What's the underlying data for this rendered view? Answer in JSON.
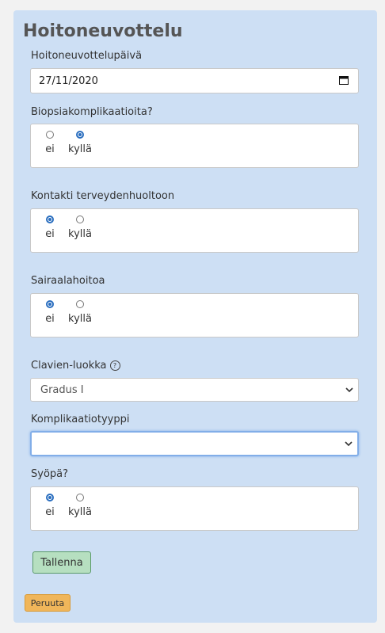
{
  "title": "Hoitoneuvottelu",
  "date": {
    "label": "Hoitoneuvottelupäivä",
    "value": "27/11/2020"
  },
  "biopsy": {
    "label": "Biopsiakomplikaatioita?",
    "opt_no": "ei",
    "opt_yes": "kyllä",
    "selected": "kyllä"
  },
  "contact": {
    "label": "Kontakti terveydenhuoltoon",
    "opt_no": "ei",
    "opt_yes": "kyllä",
    "selected": "ei"
  },
  "hospital": {
    "label": "Sairaalahoitoa",
    "opt_no": "ei",
    "opt_yes": "kyllä",
    "selected": "ei"
  },
  "clavien": {
    "label": "Clavien-luokka",
    "help": "?",
    "value": "Gradus I"
  },
  "complication_type": {
    "label": "Komplikaatiotyyppi",
    "value": ""
  },
  "cancer": {
    "label": "Syöpä?",
    "opt_no": "ei",
    "opt_yes": "kyllä",
    "selected": "ei"
  },
  "buttons": {
    "save": "Tallenna",
    "cancel": "Peruuta"
  },
  "colors": {
    "panel": "#cddff4",
    "save_bg": "#b6dfc0",
    "cancel_bg": "#f0b65a",
    "radio": "#2a6ebf"
  }
}
